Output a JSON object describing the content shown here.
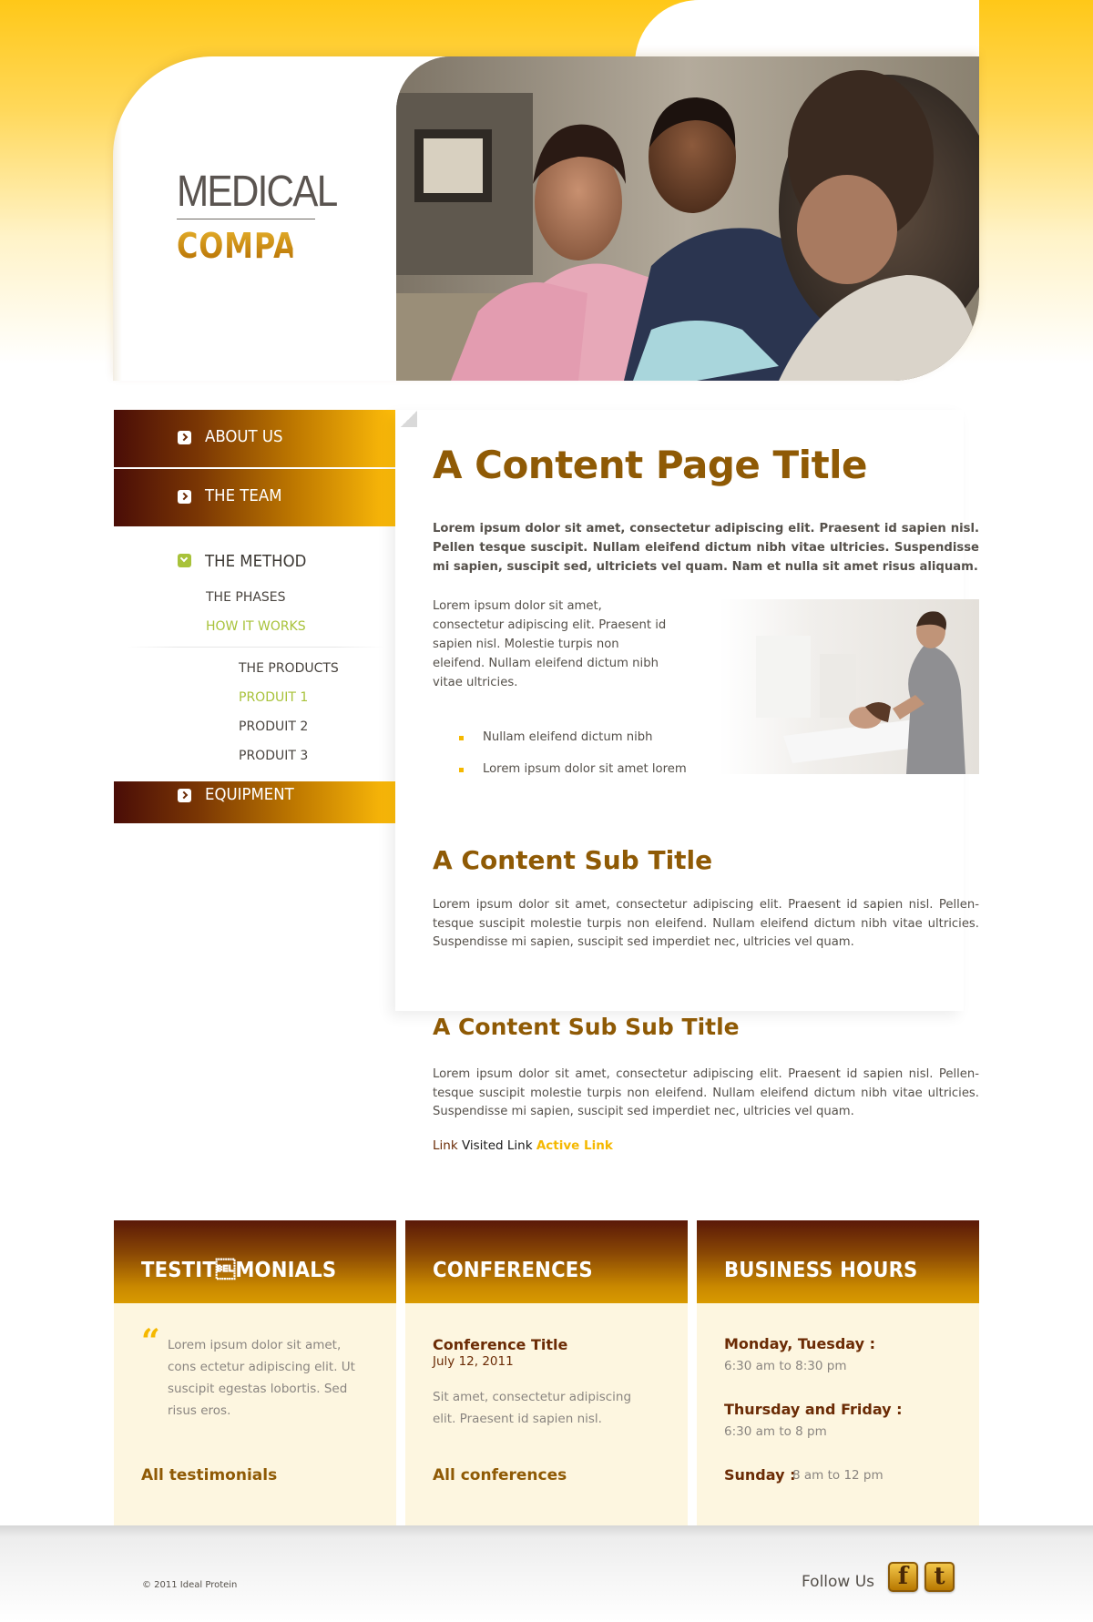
{
  "brand": {
    "logo_line1": "MEDICAL",
    "logo_line2": "COMPANY"
  },
  "colors": {
    "primary_gold": "#ffc818",
    "dark_brown": "#4a0d07",
    "title_brown": "#8f5a05",
    "active_green": "#a8c23a",
    "box_bg": "#fdf6e0"
  },
  "nav": {
    "items": [
      {
        "label": "ABOUT US",
        "icon": "chevron-right-icon"
      },
      {
        "label": "THE TEAM",
        "icon": "chevron-right-icon"
      },
      {
        "label": "THE METHOD",
        "icon": "chevron-down-icon"
      },
      {
        "label": "EQUIPMENT",
        "icon": "chevron-right-icon"
      }
    ],
    "method_sub": [
      "THE PHASES",
      "HOW IT WORKS"
    ],
    "product_sub": [
      "THE PRODUCTS",
      "PRODUIT 1",
      "PRODUIT 2",
      "PRODUIT 3"
    ]
  },
  "content": {
    "title": "A Content Page Title",
    "intro": "Lorem ipsum dolor sit amet, consectetur adipiscing elit. Praesent id sapien nisl. Pellen tesque suscipit. Nullam eleifend dictum nibh vitae ultricies. Suspendisse mi sapien, suscipit sed, ultriciets vel quam. Nam et nulla sit amet risus aliquam.",
    "para_left": "Lorem ipsum dolor sit amet, consectetur adipiscing elit. Praesent id sapien nisl. Molestie turpis non eleifend. Nullam eleifend dictum nibh vitae ultricies.",
    "bullets": [
      "Nullam eleifend dictum nibh",
      "Lorem ipsum dolor sit amet lorem"
    ],
    "sub_title": "A Content Sub Title",
    "sub_para": "Lorem ipsum dolor sit amet, consectetur adipiscing elit. Praesent id sapien nisl. Pellen-tesque suscipit molestie turpis non eleifend. Nullam eleifend dictum nibh vitae ultricies. Suspendisse mi sapien, suscipit sed imperdiet nec, ultricies vel quam.",
    "sub_sub_title": "A Content Sub Sub Title",
    "sub_sub_para": "Lorem ipsum dolor sit amet, consectetur adipiscing elit. Praesent id sapien nisl. Pellen-tesque suscipit molestie turpis non eleifend. Nullam eleifend dictum nibh vitae ultricies. Suspendisse mi sapien, suscipit sed imperdiet nec, ultricies vel quam.",
    "link": "Link",
    "visited_link": "Visited Link",
    "active_link": "Active Link"
  },
  "boxes": {
    "testimonials": {
      "title": "TESTIT\u0007MONIALS",
      "quote_mark": "“",
      "text": "Lorem ipsum dolor sit amet, cons ectetur adipiscing elit. Ut suscipit egestas lobortis. Sed risus eros.",
      "link": "All testimonials"
    },
    "conferences": {
      "title": "CONFERENCES",
      "conf_title": "Conference Title",
      "date": "July 12, 2011",
      "text": "Sit amet, consectetur adipiscing elit. Praesent id sapien nisl.",
      "link": "All conferences"
    },
    "hours": {
      "title": "BUSINESS HOURS",
      "day1": "Monday, Tuesday :",
      "time1": "6:30 am to 8:30 pm",
      "day2": "Thursday and Friday :",
      "time2": "6:30 am to 8 pm",
      "day3": "Sunday :",
      "time3": "8 am to 12 pm"
    }
  },
  "footer": {
    "copyright": "© 2011 Ideal Protein",
    "follow": "Follow Us",
    "facebook_glyph": "f",
    "twitter_glyph": "t"
  }
}
